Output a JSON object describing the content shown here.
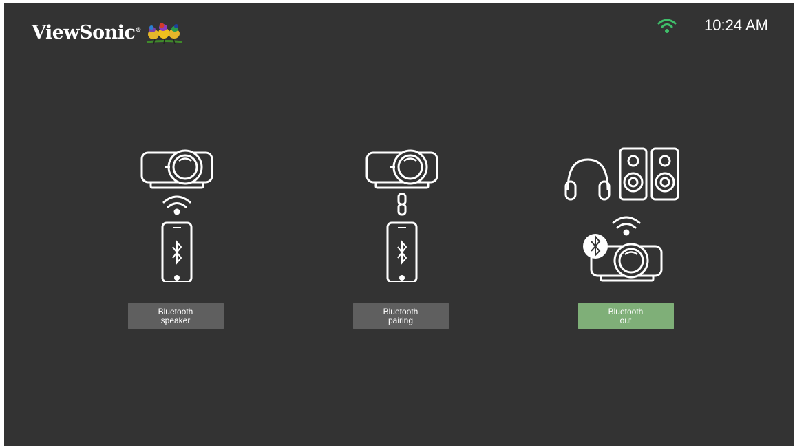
{
  "header": {
    "brand": "ViewSonic",
    "brand_mark": "®",
    "logo_icon": "gouldian-finches-logo",
    "wifi_icon": "wifi-icon",
    "time": "10:24 AM",
    "wifi_color": "#3fbf6a"
  },
  "options": [
    {
      "label": "Bluetooth\nspeaker",
      "illustration": "projector-wifi-phone-bluetooth",
      "selected": false
    },
    {
      "label": "Bluetooth\npairing",
      "illustration": "projector-link-phone-bluetooth",
      "selected": false
    },
    {
      "label": "Bluetooth\nout",
      "illustration": "headphones-speakers-projector-bluetooth",
      "selected": true
    }
  ],
  "colors": {
    "background": "#333333",
    "button": "#5f5f5f",
    "button_selected": "#7faf78",
    "icon_stroke": "#ffffff"
  }
}
